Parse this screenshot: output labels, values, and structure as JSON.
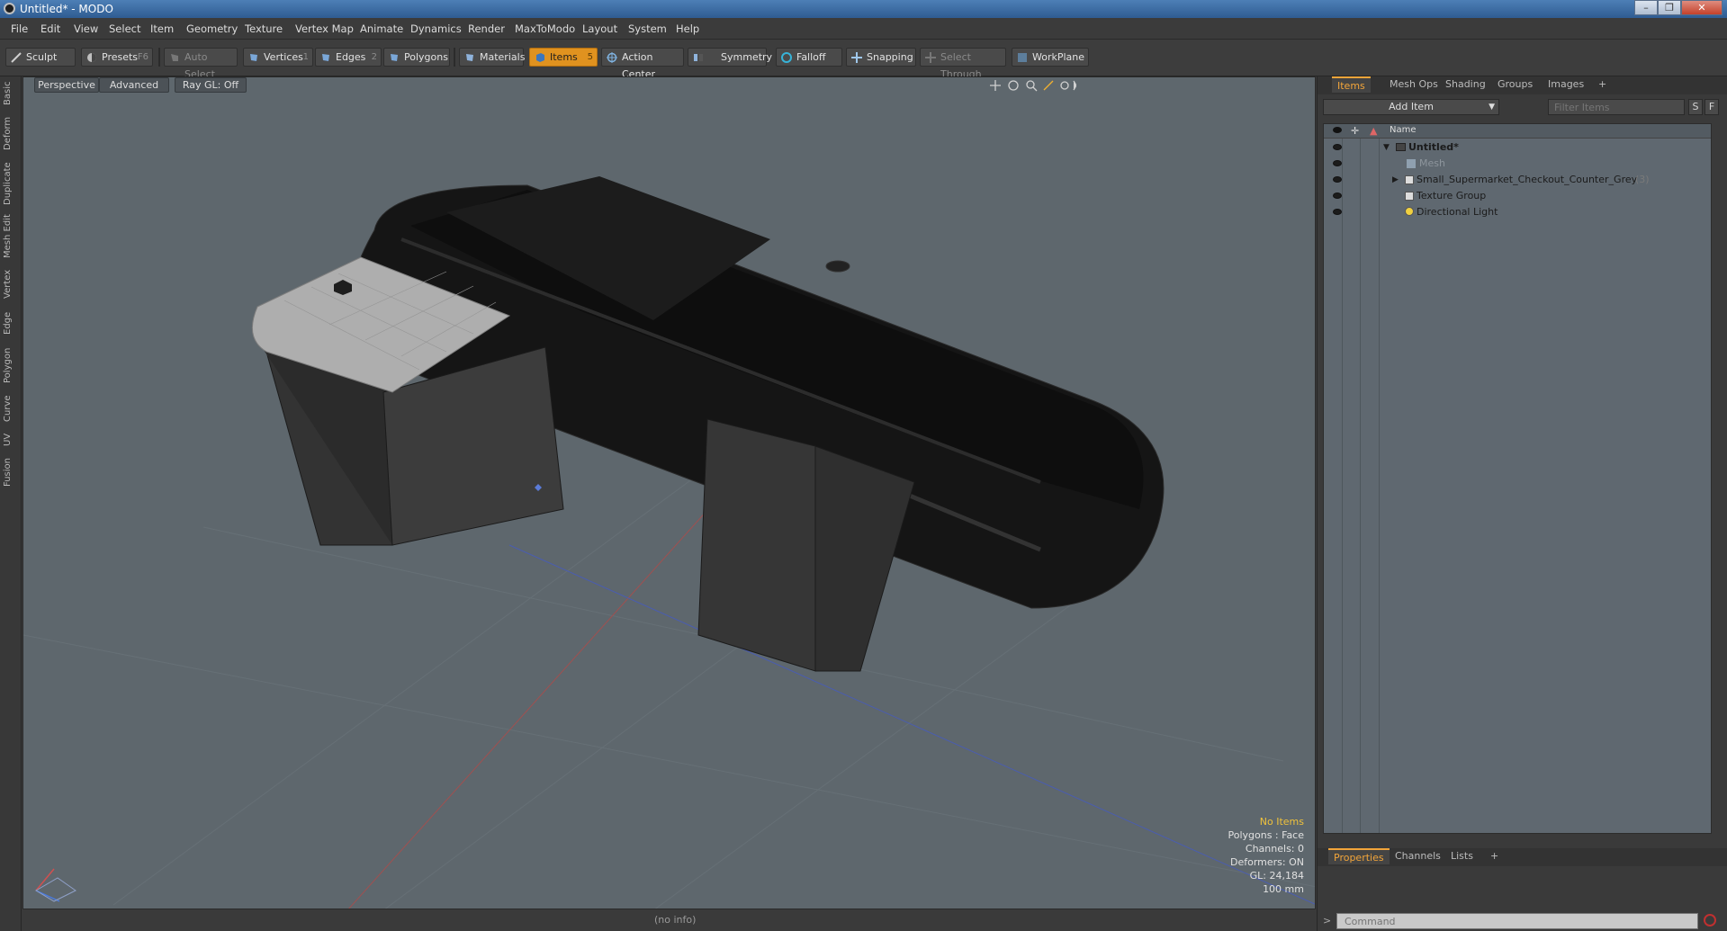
{
  "window": {
    "title": "Untitled* - MODO"
  },
  "menu": [
    "File",
    "Edit",
    "View",
    "Select",
    "Item",
    "Geometry",
    "Texture",
    "Vertex Map",
    "Animate",
    "Dynamics",
    "Render",
    "MaxToModo",
    "Layout",
    "System",
    "Help"
  ],
  "toolbar": {
    "sculpt": "Sculpt",
    "presets": "Presets",
    "presets_key": "F6",
    "auto_select": "Auto Select",
    "vertices": "Vertices",
    "vertices_key": "1",
    "edges": "Edges",
    "edges_key": "2",
    "polygons": "Polygons",
    "materials": "Materials",
    "items": "Items",
    "items_key": "5",
    "action_center": "Action Center",
    "symmetry": "Symmetry",
    "falloff": "Falloff",
    "snapping": "Snapping",
    "select_through": "Select Through",
    "workplane": "WorkPlane"
  },
  "left_tabs": [
    "Basic",
    "Deform",
    "Duplicate",
    "Mesh Edit",
    "Vertex",
    "Edge",
    "Polygon",
    "Curve",
    "UV",
    "Fusion"
  ],
  "viewport": {
    "perspective": "Perspective",
    "advanced": "Advanced",
    "raygl": "Ray GL: Off",
    "hud": {
      "no_items": "No Items",
      "polygons": "Polygons : Face",
      "channels": "Channels: 0",
      "deformers": "Deformers: ON",
      "gl": "GL: 24,184",
      "scale": "100 mm"
    }
  },
  "status": {
    "info": "(no info)"
  },
  "right_panel": {
    "tabs": [
      "Items",
      "Mesh Ops",
      "Shading",
      "Groups",
      "Images"
    ],
    "add_item": "Add Item",
    "filter_placeholder": "Filter Items",
    "s_btn": "S",
    "f_btn": "F",
    "name_header": "Name",
    "rows": [
      {
        "label": "Untitled*"
      },
      {
        "label": "Mesh"
      },
      {
        "label": "Small_Supermarket_Checkout_Counter_Grey",
        "count": "(3)"
      },
      {
        "label": "Texture Group"
      },
      {
        "label": "Directional Light"
      }
    ],
    "bottom_tabs": [
      "Properties",
      "Channels",
      "Lists"
    ],
    "command_placeholder": "Command"
  },
  "colors": {
    "accent": "#e0921f",
    "viewport_bg": "#5e676d",
    "titlebar": "#3d6ea6"
  }
}
